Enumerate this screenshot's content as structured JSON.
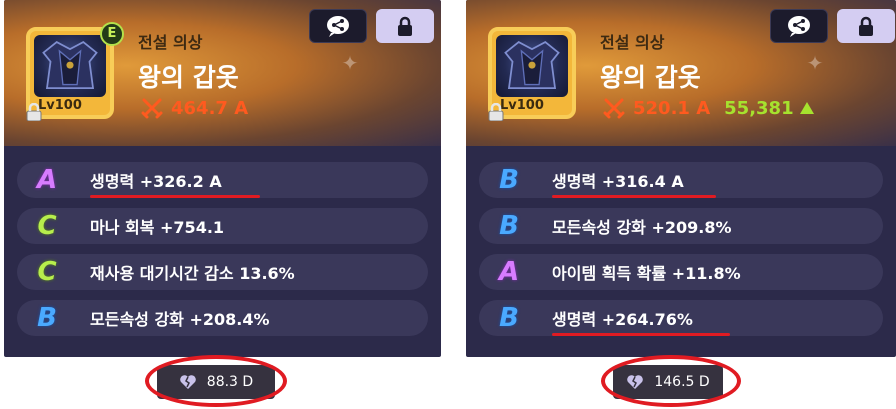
{
  "cards": [
    {
      "grade_badge": "E",
      "rarity": "전설 의상",
      "name": "왕의 갑옷",
      "level": "Lv100",
      "power": "464.7 A",
      "power_diff": "",
      "stats": [
        {
          "grade": "A",
          "text": "생명력 +326.2 A"
        },
        {
          "grade": "C",
          "text": "마나 회복 +754.1"
        },
        {
          "grade": "C",
          "text": "재사용 대기시간 감소 13.6%"
        },
        {
          "grade": "B",
          "text": "모든속성 강화 +208.4%"
        }
      ],
      "score": "88.3 D"
    },
    {
      "grade_badge": "",
      "rarity": "전설 의상",
      "name": "왕의 갑옷",
      "level": "Lv100",
      "power": "520.1 A",
      "power_diff": "55,381",
      "stats": [
        {
          "grade": "B",
          "text": "생명력 +316.4 A"
        },
        {
          "grade": "B",
          "text": "모든속성 강화 +209.8%"
        },
        {
          "grade": "A",
          "text": "아이템 획득 확률 +11.8%"
        },
        {
          "grade": "B",
          "text": "생명력 +264.76%"
        }
      ],
      "score": "146.5 D"
    }
  ],
  "icons": {
    "share": "share-icon",
    "lock": "lock-icon",
    "power": "crossed-swords-icon",
    "heart": "broken-heart-icon",
    "up": "up-triangle-icon"
  },
  "colors": {
    "grade_a": "#d77cff",
    "grade_b": "#4aa9ff",
    "grade_c": "#b7ee4c",
    "power": "#ff5a1f",
    "power_up": "#a6e22e",
    "highlight": "#e01b22"
  }
}
